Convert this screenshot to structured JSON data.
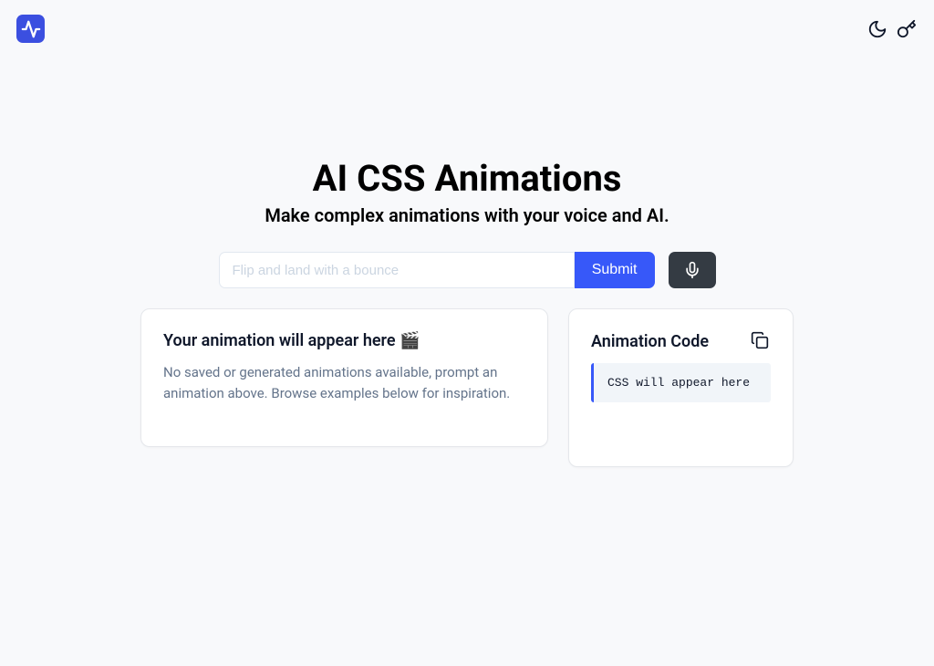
{
  "header": {
    "logo_name": "activity-icon"
  },
  "title": "AI CSS Animations",
  "subtitle": "Make complex animations with your voice and AI.",
  "input": {
    "placeholder": "Flip and land with a bounce",
    "submit_label": "Submit"
  },
  "preview_card": {
    "title": "Your animation will appear here 🎬",
    "empty_text": "No saved or generated animations available, prompt an animation above. Browse examples below for inspiration."
  },
  "code_card": {
    "title": "Animation Code",
    "placeholder": "CSS will appear here"
  }
}
